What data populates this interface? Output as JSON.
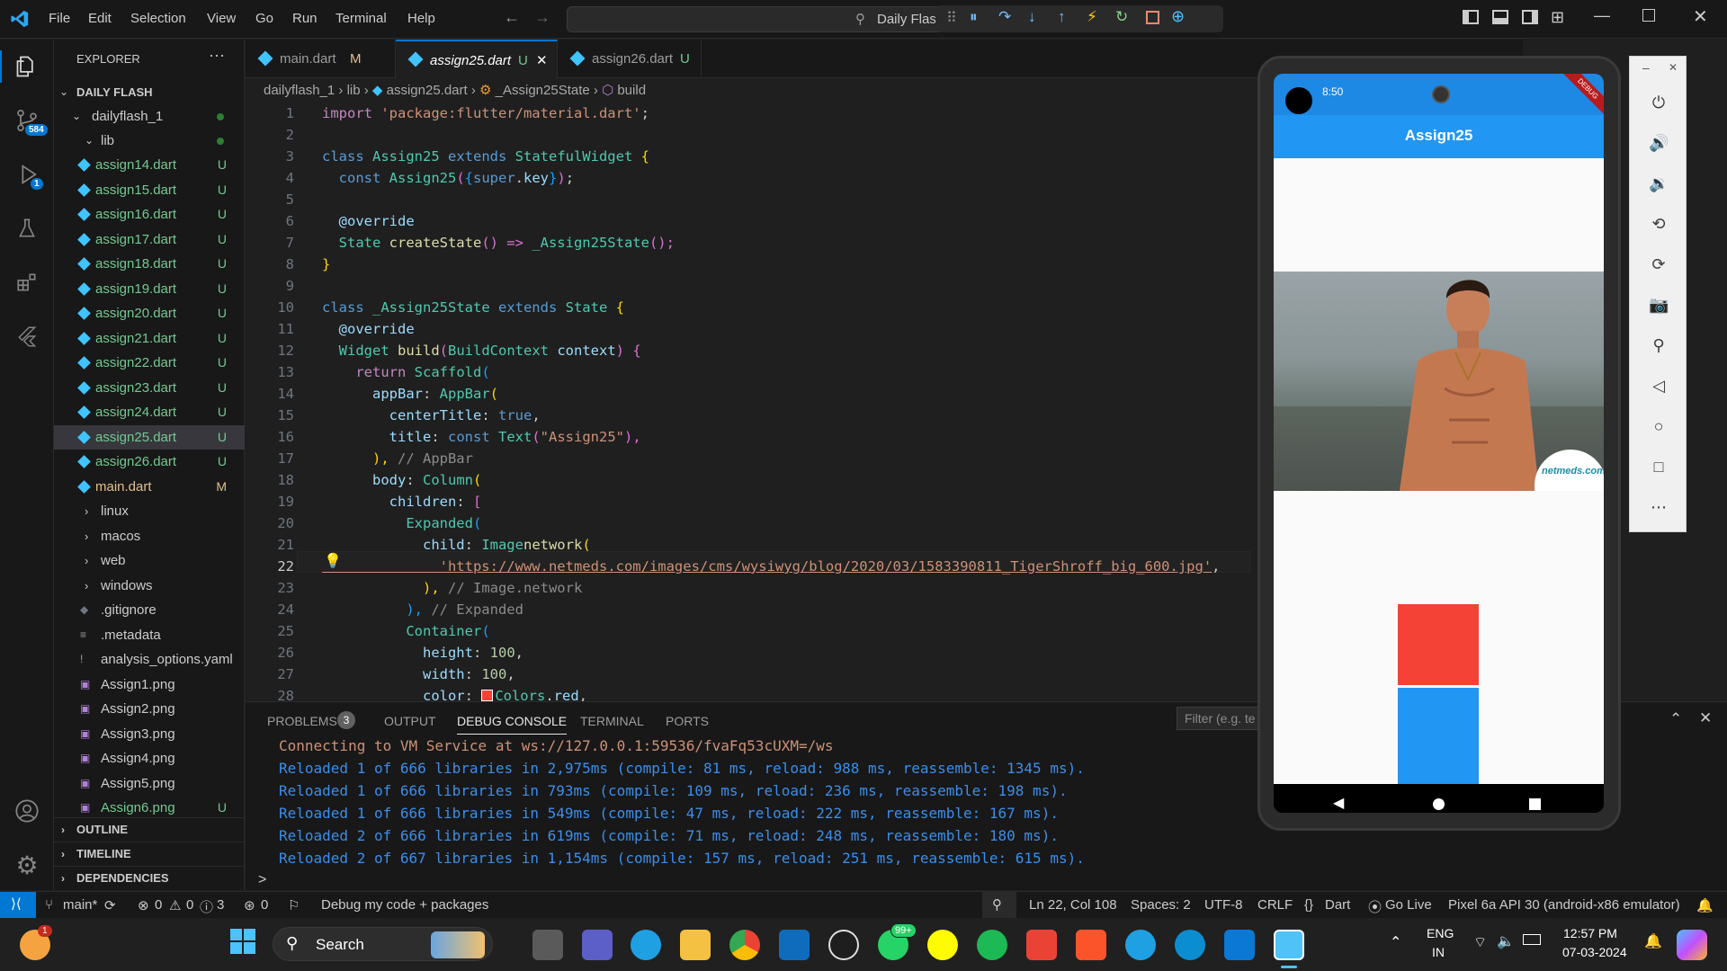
{
  "menu": [
    "File",
    "Edit",
    "Selection",
    "View",
    "Go",
    "Run",
    "Terminal",
    "Help"
  ],
  "command_center": {
    "text": "Daily Flash"
  },
  "explorer": {
    "title": "EXPLORER",
    "root": "DAILY FLASH",
    "project": "dailyflash_1",
    "lib": "lib",
    "files": [
      {
        "name": "assign14.dart",
        "status": "U"
      },
      {
        "name": "assign15.dart",
        "status": "U"
      },
      {
        "name": "assign16.dart",
        "status": "U"
      },
      {
        "name": "assign17.dart",
        "status": "U"
      },
      {
        "name": "assign18.dart",
        "status": "U"
      },
      {
        "name": "assign19.dart",
        "status": "U"
      },
      {
        "name": "assign20.dart",
        "status": "U"
      },
      {
        "name": "assign21.dart",
        "status": "U"
      },
      {
        "name": "assign22.dart",
        "status": "U"
      },
      {
        "name": "assign23.dart",
        "status": "U"
      },
      {
        "name": "assign24.dart",
        "status": "U"
      },
      {
        "name": "assign25.dart",
        "status": "U"
      },
      {
        "name": "assign26.dart",
        "status": "U"
      },
      {
        "name": "main.dart",
        "status": "M"
      }
    ],
    "folders": [
      "linux",
      "macos",
      "web",
      "windows"
    ],
    "others": [
      {
        "name": ".gitignore",
        "status": ""
      },
      {
        "name": ".metadata",
        "status": ""
      },
      {
        "name": "analysis_options.yaml",
        "status": ""
      },
      {
        "name": "Assign1.png",
        "status": ""
      },
      {
        "name": "Assign2.png",
        "status": ""
      },
      {
        "name": "Assign3.png",
        "status": ""
      },
      {
        "name": "Assign4.png",
        "status": ""
      },
      {
        "name": "Assign5.png",
        "status": ""
      },
      {
        "name": "Assign6.png",
        "status": "U"
      }
    ],
    "sections": [
      "OUTLINE",
      "TIMELINE",
      "DEPENDENCIES"
    ]
  },
  "activity_badges": {
    "scm": "584",
    "debug": "1"
  },
  "tabs": [
    {
      "label": "main.dart",
      "status": "M"
    },
    {
      "label": "assign25.dart",
      "status": "U"
    },
    {
      "label": "assign26.dart",
      "status": "U"
    }
  ],
  "breadcrumb": [
    "dailyflash_1",
    "lib",
    "assign25.dart",
    "_Assign25State",
    "build"
  ],
  "line_numbers": [
    "1",
    "2",
    "3",
    "4",
    "5",
    "6",
    "7",
    "8",
    "9",
    "10",
    "11",
    "12",
    "13",
    "14",
    "15",
    "16",
    "17",
    "18",
    "19",
    "20",
    "21",
    "22",
    "23",
    "24",
    "25",
    "26",
    "27",
    "28"
  ],
  "code": {
    "l1a": "import ",
    "l1b": "'package:flutter/material.dart'",
    "l1c": ";",
    "l3a": "class ",
    "l3b": "Assign25 ",
    "l3c": "extends ",
    "l3d": "StatefulWidget ",
    "l3e": "{",
    "l4a": "  const ",
    "l4b": "Assign25",
    "l4c": "(",
    "l4d": "{",
    "l4e": "super",
    "l4f": ".",
    "l4g": "key",
    "l4h": "}",
    "l4i": ")",
    "l4j": ";",
    "l6a": "  @override",
    "l7a": "  State ",
    "l7b": "createState",
    "l7c": "() => ",
    "l7d": "_Assign25State",
    "l7e": "();",
    "l8a": "}",
    "l10a": "class ",
    "l10b": "_Assign25State ",
    "l10c": "extends ",
    "l10d": "State ",
    "l10e": "{",
    "l11a": "  @override",
    "l12a": "  Widget ",
    "l12b": "build",
    "l12c": "(",
    "l12d": "BuildContext ",
    "l12e": "context",
    "l12f": ") ",
    "l12g": "{",
    "l13a": "    return ",
    "l13b": "Scaffold",
    "l13c": "(",
    "l14a": "      appBar",
    "l14b": ": ",
    "l14c": "AppBar",
    "l14d": "(",
    "l15a": "        centerTitle",
    "l15b": ": ",
    "l15c": "true",
    ",": ",",
    "l16a": "        title",
    "l16b": ": ",
    "l16c": "const ",
    "l16d": "Text",
    "l16e": "(",
    "l16f": "\"Assign25\"",
    "l16g": "),",
    "l17a": "      ),",
    "l17b": " // AppBar",
    "l18a": "      body",
    "l18b": ": ",
    "l18c": "Column",
    "l18d": "(",
    "l19a": "        children",
    "l19b": ": ",
    "l19c": "[",
    "l20a": "          Expanded",
    "l20b": "(",
    "l21a": "            child",
    "l21b": ": ",
    "l21c": "Image",
    ".": ".",
    "l21d": "network",
    "l21e": "(",
    "l22a": "              'https://www.netmeds.com/images/cms/wysiwyg/blog/2020/03/1583390811_TigerShroff_big_600.jpg'",
    "l22b": ",",
    "l23a": "            ),",
    "l23b": " // Image.network",
    "l24a": "          ),",
    "l24b": " // Expanded",
    "l25a": "          Container",
    "l25b": "(",
    "l26a": "            height",
    "l26b": ": ",
    "l26c": "100",
    "l27a": "            width",
    "l27b": ": ",
    "l27c": "100",
    "l28a": "            color",
    "l28b": ": ",
    "l28c": "Colors",
    "l28d": ".",
    "l28e": "red"
  },
  "panel": {
    "tabs": [
      "PROBLEMS",
      "OUTPUT",
      "DEBUG CONSOLE",
      "TERMINAL",
      "PORTS"
    ],
    "problems_count": "3",
    "filter_placeholder": "Filter (e.g. te",
    "lines": [
      "Connecting to VM Service at ws://127.0.0.1:59536/fvaFq53cUXM=/ws",
      "Reloaded 1 of 666 libraries in 2,975ms (compile: 81 ms, reload: 988 ms, reassemble: 1345 ms).",
      "Reloaded 1 of 666 libraries in 793ms (compile: 109 ms, reload: 236 ms, reassemble: 198 ms).",
      "Reloaded 1 of 666 libraries in 549ms (compile: 47 ms, reload: 222 ms, reassemble: 167 ms).",
      "Reloaded 2 of 666 libraries in 619ms (compile: 71 ms, reload: 248 ms, reassemble: 180 ms).",
      "Reloaded 2 of 667 libraries in 1,154ms (compile: 157 ms, reload: 251 ms, reassemble: 615 ms)."
    ],
    "prompt": ">"
  },
  "status": {
    "branch": "main*",
    "errors": "0",
    "warnings": "0",
    "info": "3",
    "ports": "0",
    "debug": "Debug my code + packages",
    "position": "Ln 22, Col 108",
    "spaces": "Spaces: 2",
    "encoding": "UTF-8",
    "eol": "CRLF",
    "language": "Dart",
    "golive": "Go Live",
    "device": "Pixel 6a API 30 (android-x86 emulator)"
  },
  "phone": {
    "time": "8:50",
    "appbar_title": "Assign25",
    "debug_banner": "DEBUG",
    "watermark": "netmeds.com",
    "colors": {
      "appbar": "#2196f3",
      "red": "#f44336",
      "blue": "#2196f3"
    }
  },
  "taskbar": {
    "search": "Search",
    "lang1": "ENG",
    "lang2": "IN",
    "time": "12:57 PM",
    "date": "07-03-2024",
    "whatsapp_badge": "99+",
    "weather_badge": "1"
  }
}
